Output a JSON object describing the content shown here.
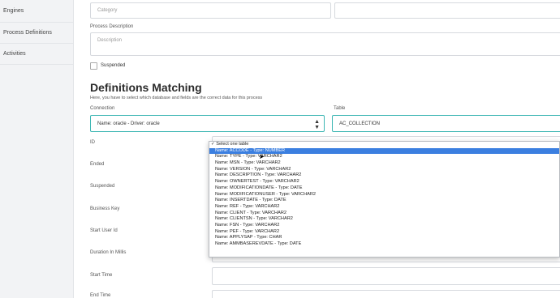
{
  "sidebar": {
    "items": [
      {
        "label": "Engines"
      },
      {
        "label": "Process Definitions"
      },
      {
        "label": "Activities"
      }
    ]
  },
  "form": {
    "category_placeholder": "Category",
    "process_description_label": "Process Description",
    "description_placeholder": "Description",
    "suspended_label": "Suspended"
  },
  "matching": {
    "title": "Definitions Matching",
    "subtitle": "Here, you have to select which database and fields are the correct data for this process",
    "connection_label": "Connection",
    "connection_value": "Name: oracle - Driver: oracle",
    "table_label": "Table",
    "table_value": "AC_COLLECTION",
    "fields": [
      {
        "label": "ID"
      },
      {
        "label": "Ended"
      },
      {
        "label": "Suspended"
      },
      {
        "label": "Business Key"
      },
      {
        "label": "Start User Id"
      },
      {
        "label": "Duration In Millis"
      },
      {
        "label": "Start Time"
      },
      {
        "label": "End Time"
      }
    ]
  },
  "dropdown": {
    "options": [
      "✓ Select one table",
      "Name: ACCODE - Type: NUMBER",
      "Name: TYPE - Type: VARCHAR2",
      "Name: MSN - Type: VARCHAR2",
      "Name: VERSION - Type: VARCHAR2",
      "Name: DESCRIPTION - Type: VARCHAR2",
      "Name: OWNERTEST - Type: VARCHAR2",
      "Name: MODIFICATIONDATE - Type: DATE",
      "Name: MODIFICATIONUSER - Type: VARCHAR2",
      "Name: INSERTDATE - Type: DATE",
      "Name: REF - Type: VARCHAR2",
      "Name: CLIENT - Type: VARCHAR2",
      "Name: CLIENTSN - Type: VARCHAR2",
      "Name: FSN - Type: VARCHAR2",
      "Name: PEF - Type: VARCHAR2",
      "Name: APPLYSAP - Type: CHAR",
      "Name: AMMBASEREVDATE - Type: DATE"
    ],
    "selected_index": 1
  },
  "colors": {
    "accent": "#3fb7b4",
    "selection": "#3b7fe0"
  }
}
